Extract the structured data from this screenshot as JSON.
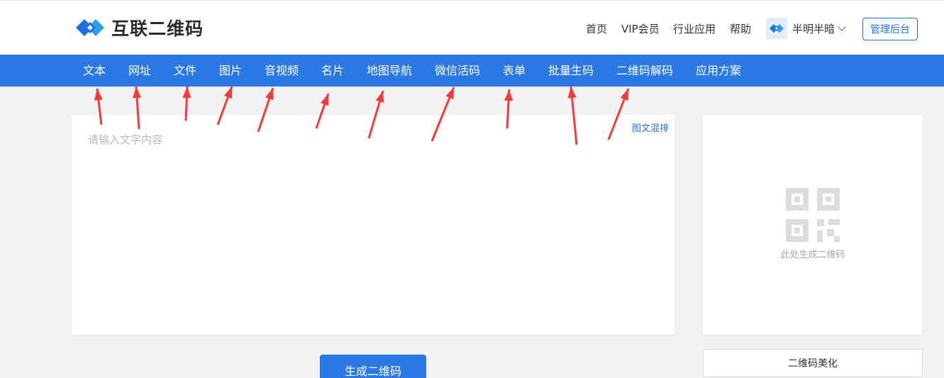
{
  "brand": {
    "name": "互联二维码",
    "color": "#2a78e4"
  },
  "top_nav": {
    "home": "首页",
    "vip": "VIP会员",
    "industry": "行业应用",
    "help": "帮助"
  },
  "user": {
    "name": "半明半暗"
  },
  "admin_button": "管理后台",
  "tabs": [
    {
      "label": "文本"
    },
    {
      "label": "网址"
    },
    {
      "label": "文件"
    },
    {
      "label": "图片"
    },
    {
      "label": "音视频"
    },
    {
      "label": "名片"
    },
    {
      "label": "地图导航"
    },
    {
      "label": "微信活码"
    },
    {
      "label": "表单"
    },
    {
      "label": "批量生码"
    },
    {
      "label": "二维码解码"
    },
    {
      "label": "应用方案"
    }
  ],
  "editor": {
    "placeholder": "请输入文字内容",
    "value": "",
    "mix_link": "图文混排"
  },
  "qr_preview": {
    "hint": "此处生成二维码",
    "icon": "qr-code-icon"
  },
  "generate_button": "生成二维码",
  "beautify_button": "二维码美化",
  "annotation": {
    "color": "#f53a3a",
    "icon": "red-arrow-icon"
  }
}
